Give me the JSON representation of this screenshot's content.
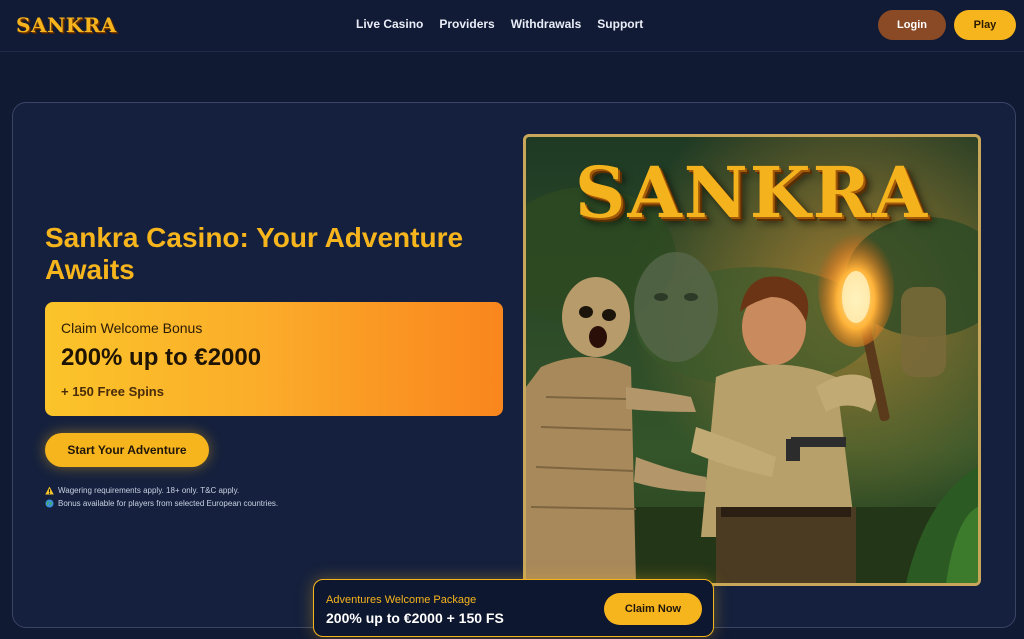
{
  "header": {
    "logo": "SANKRA",
    "nav": [
      "Live Casino",
      "Providers",
      "Withdrawals",
      "Support"
    ],
    "login_label": "Login",
    "play_label": "Play"
  },
  "hero": {
    "title": "Sankra Casino: Your Adventure Awaits",
    "bonus": {
      "eyebrow": "Claim Welcome Bonus",
      "amount": "200% up to €2000",
      "extra": "+ 150 Free Spins"
    },
    "cta_label": "Start Your Adventure",
    "notes": [
      {
        "icon": "warning-icon",
        "text": "Wagering requirements apply. 18+ only. T&C apply."
      },
      {
        "icon": "globe-icon",
        "text": "Bonus available for players from selected European countries."
      }
    ],
    "art_logo": "SANKRA"
  },
  "promo": {
    "label": "Adventures Welcome Package",
    "offer": "200% up to €2000 + 150 FS",
    "button_label": "Claim Now"
  },
  "colors": {
    "background": "#101a33",
    "accent": "#f7b51d",
    "login": "#8b4a26",
    "bonus_gradient_start": "#fbc42a",
    "bonus_gradient_end": "#f9861e"
  }
}
